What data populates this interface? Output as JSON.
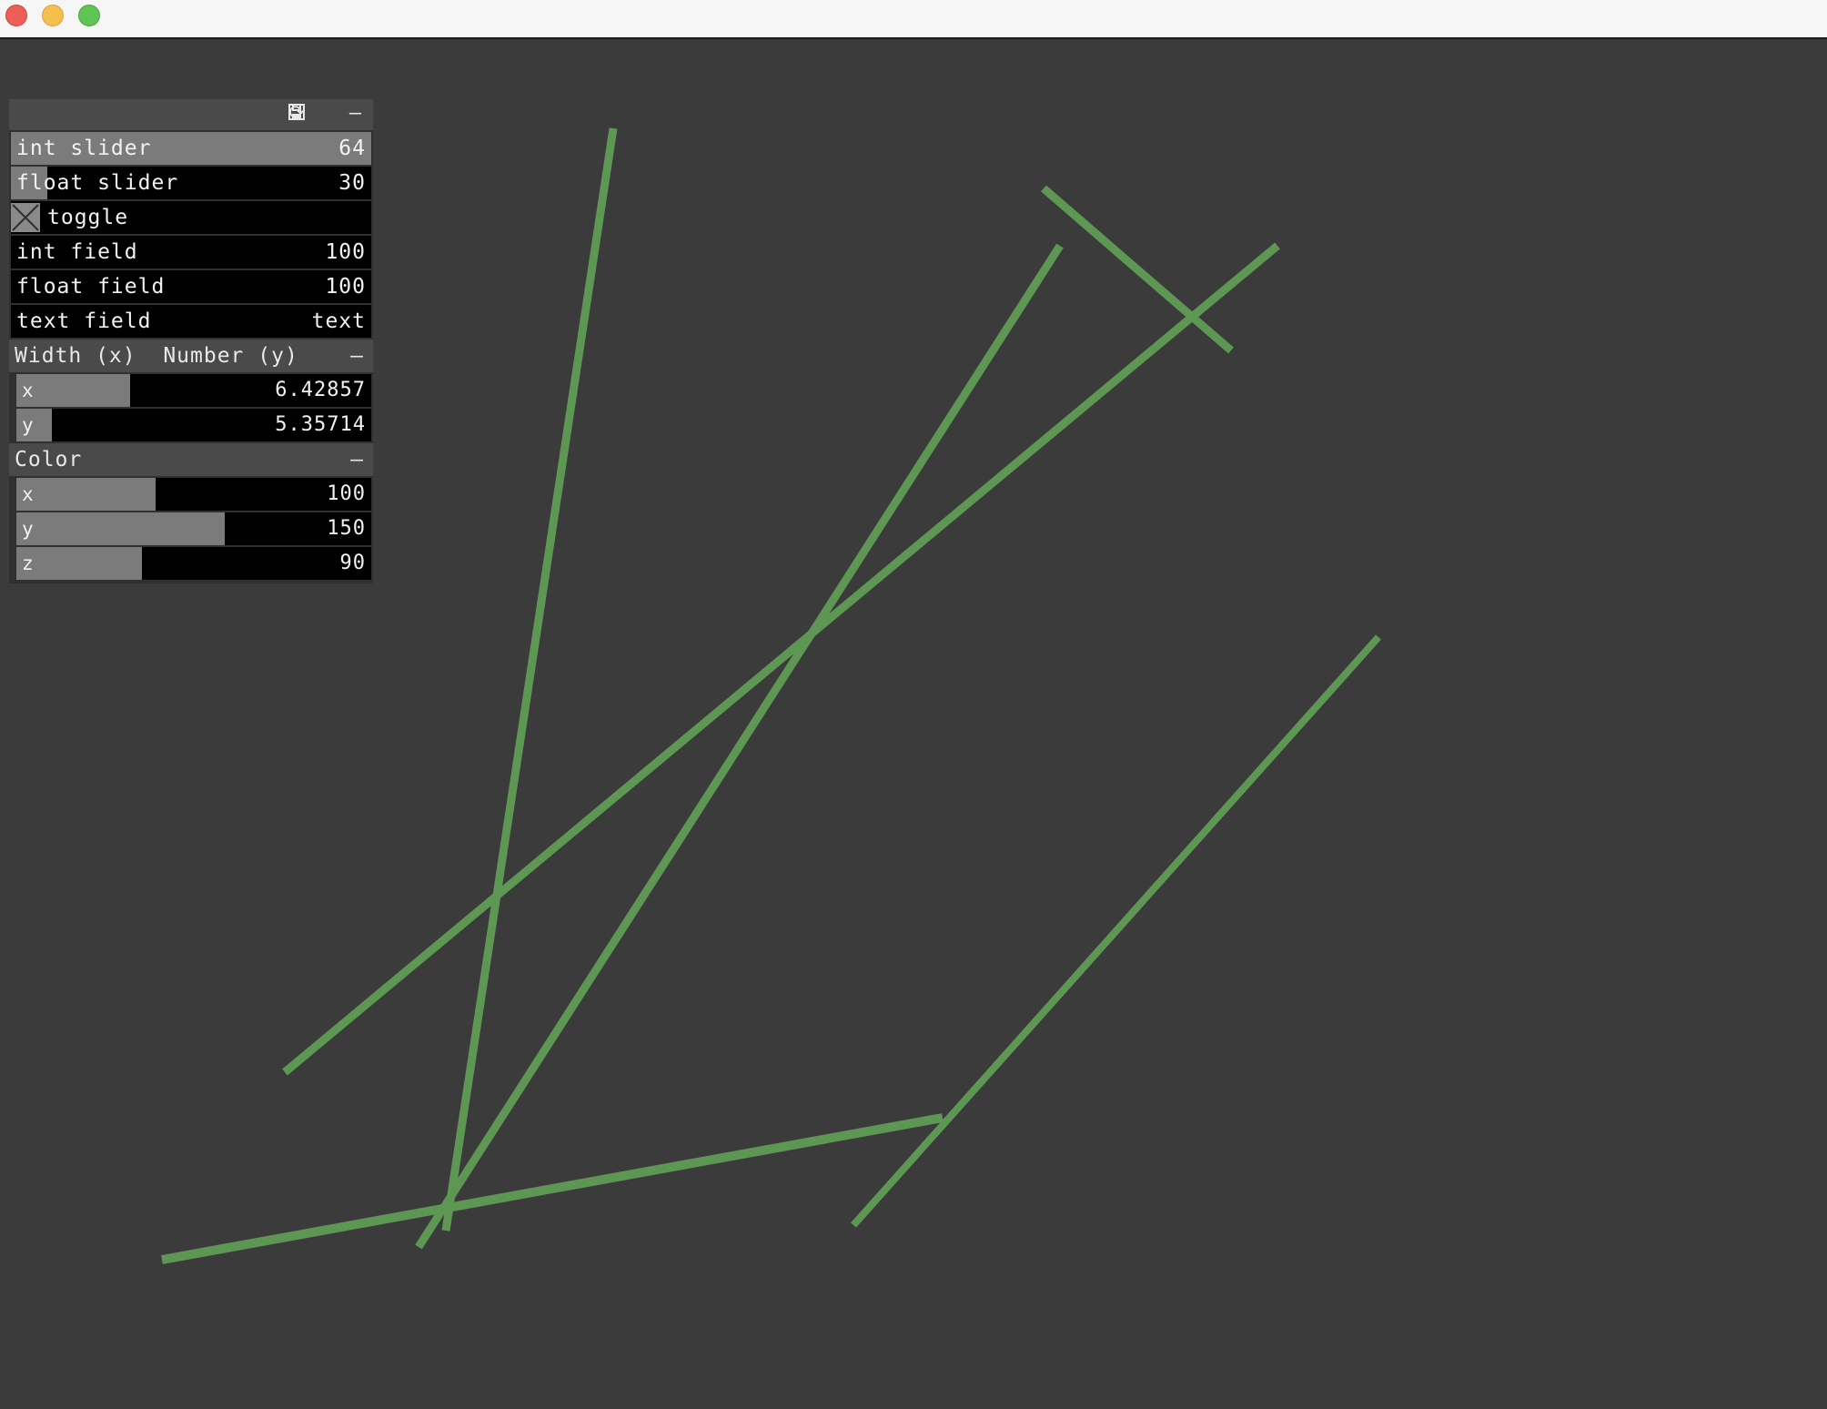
{
  "window": {
    "buttons": [
      "close",
      "minimize",
      "zoom"
    ]
  },
  "canvas": {
    "background": "#3b3b3b",
    "line_color": "#5e9654"
  },
  "panel": {
    "header_icons": {
      "reload": "⟳",
      "save": "🖫",
      "collapse": "–"
    },
    "rows": {
      "int_slider": {
        "label": "int slider",
        "value": "64",
        "fill": 1.0
      },
      "float_slider": {
        "label": "float slider",
        "value": "30",
        "fill": 0.1
      },
      "toggle": {
        "label": "toggle",
        "checked": true
      },
      "int_field": {
        "label": "int field",
        "value": "100"
      },
      "float_field": {
        "label": "float field",
        "value": "100"
      },
      "text_field": {
        "label": "text field",
        "value": "text"
      }
    },
    "groups": {
      "width_number": {
        "title": "Width (x)  Number (y)",
        "collapse": "–",
        "x": {
          "label": "x",
          "value": "6.42857",
          "fill": 0.32
        },
        "y": {
          "label": "y",
          "value": "5.35714",
          "fill": 0.1
        }
      },
      "color": {
        "title": "Color",
        "collapse": "–",
        "x": {
          "label": "x",
          "value": "100",
          "fill": 0.392
        },
        "y": {
          "label": "y",
          "value": "150",
          "fill": 0.588
        },
        "z": {
          "label": "z",
          "value": "90",
          "fill": 0.353
        }
      }
    }
  }
}
